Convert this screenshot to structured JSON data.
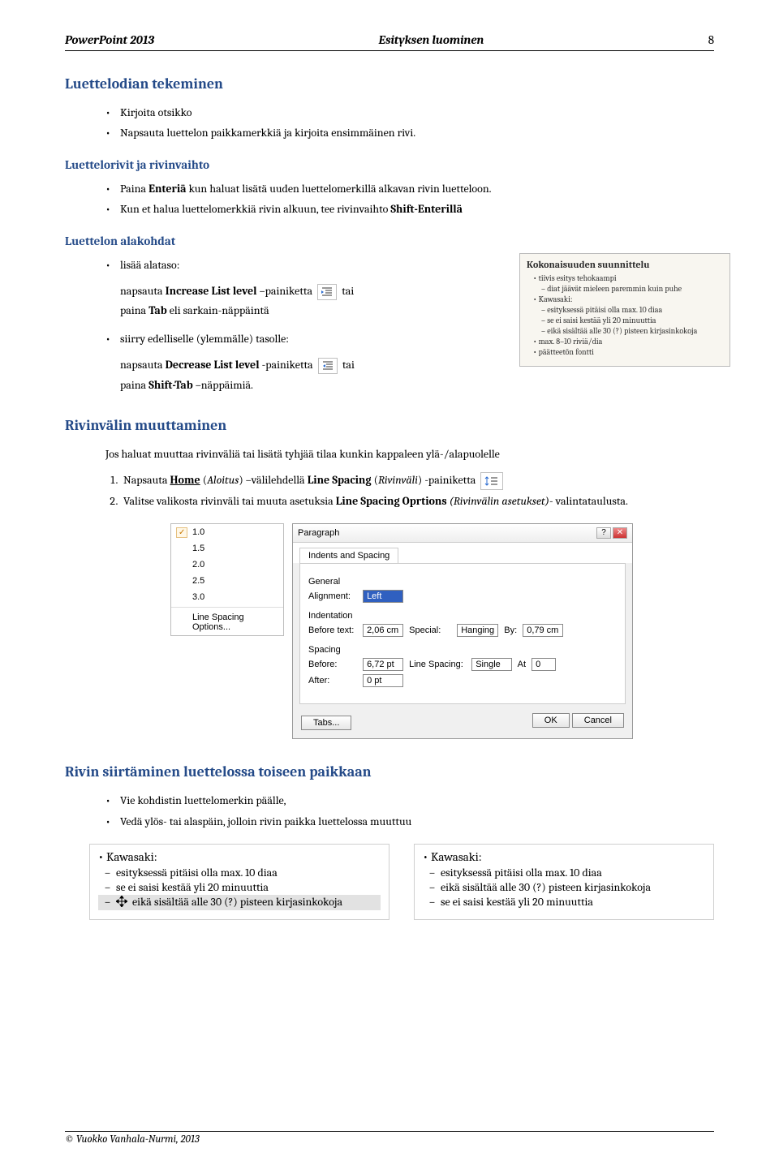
{
  "header": {
    "left": "PowerPoint 2013",
    "center": "Esityksen luominen",
    "right": "8"
  },
  "section1": {
    "title": "Luettelodian tekeminen",
    "bullets": {
      "b1": "Kirjoita otsikko",
      "b2": "Napsauta luettelon paikkamerkkiä ja kirjoita ensimmäinen rivi."
    }
  },
  "section2": {
    "title": "Luettelorivit ja rivinvaihto",
    "b1_pre": "Paina ",
    "b1_key": "Enteriä",
    "b1_post": " kun haluat lisätä uuden luettelomerkillä alkavan rivin luetteloon.",
    "b2_pre": "Kun et halua luettelomerkkiä rivin alkuun, tee rivinvaihto ",
    "b2_key": "Shift-Enterillä"
  },
  "section3": {
    "title": "Luettelon alakohdat",
    "b1": "lisää alataso:",
    "inc_pre": "napsauta ",
    "inc_bold": "Increase List level",
    "inc_mid": " –painiketta",
    "inc_post": " tai",
    "inc_line2_pre": "paina ",
    "inc_line2_key": "Tab",
    "inc_line2_post": " eli sarkain-näppäintä",
    "b2": "siirry edelliselle (ylemmälle) tasolle:",
    "dec_pre": "napsauta ",
    "dec_bold": "Decrease List level",
    "dec_mid": " -painiketta",
    "dec_post": " tai",
    "dec_line2_pre": "paina ",
    "dec_line2_key": "Shift-Tab",
    "dec_line2_post": " –näppäimiä."
  },
  "thumb": {
    "title": "Kokonaisuuden suunnittelu",
    "l1": "tiivis esitys tehokaampi",
    "l1s": "diat jäävät mieleen paremmin kuin puhe",
    "l2": "Kawasaki:",
    "l2a": "esityksessä pitäisi olla max. 10 diaa",
    "l2b": "se ei saisi kestää yli 20 minuuttia",
    "l2c": "eikä sisältää alle 30 (?) pisteen kirjasinkokoja",
    "l3": "max. 8–10 riviä/dia",
    "l4": "päätteetön fontti"
  },
  "section4": {
    "title": "Rivinvälin muuttaminen",
    "intro": "Jos haluat muuttaa rivinväliä tai lisätä tyhjää tilaa kunkin kappaleen ylä-/alapuolelle",
    "n1_pre": "Napsauta ",
    "n1_home_u": "Home",
    "n1_mid": " (",
    "n1_italic": "Aloitus",
    "n1_mid2": ") –välilehdellä ",
    "n1_bold": "Line Spacing",
    "n1_mid3": " (",
    "n1_italic2": "Rivinväli",
    "n1_post": ") -painiketta",
    "n2_pre": "Valitse valikosta rivinväli tai muuta asetuksia ",
    "n2_bold": "Line Spacing Oprtions ",
    "n2_italic": "(Rivinvälin asetukset)",
    "n2_post": "- valintataulusta."
  },
  "spacing_menu": {
    "o1": "1.0",
    "o2": "1.5",
    "o3": "2.0",
    "o4": "2.5",
    "o5": "3.0",
    "opt": "Line Spacing Options..."
  },
  "dialog": {
    "title": "Paragraph",
    "tab": "Indents and Spacing",
    "gen": "General",
    "align_lbl": "Alignment:",
    "align_val": "Left",
    "ind": "Indentation",
    "before_text_lbl": "Before text:",
    "before_text_val": "2,06 cm",
    "special_lbl": "Special:",
    "special_val": "Hanging",
    "by_lbl": "By:",
    "by_val": "0,79 cm",
    "spc": "Spacing",
    "before_lbl": "Before:",
    "before_val": "6,72 pt",
    "linesp_lbl": "Line Spacing:",
    "linesp_val": "Single",
    "at_lbl": "At",
    "at_val": "0",
    "after_lbl": "After:",
    "after_val": "0 pt",
    "tabs_btn": "Tabs...",
    "ok": "OK",
    "cancel": "Cancel"
  },
  "section5": {
    "title": "Rivin siirtäminen luettelossa toiseen paikkaan",
    "b1": "Vie kohdistin luettelomerkin päälle,",
    "b2": "Vedä ylös- tai alaspäin, jolloin rivin paikka luettelossa muuttuu"
  },
  "panels": {
    "left": {
      "top": "Kawasaki:",
      "l1": "esityksessä pitäisi olla max. 10 diaa",
      "l2": "se ei saisi kestää yli 20 minuuttia",
      "l3": "eikä sisältää alle 30 (?) pisteen kirjasinkokoja"
    },
    "right": {
      "top": "Kawasaki:",
      "l1": "esityksessä pitäisi olla max. 10 diaa",
      "l2": "eikä sisältää alle 30 (?) pisteen kirjasinkokoja",
      "l3": "se ei saisi kestää yli 20 minuuttia"
    }
  },
  "footer": {
    "text": "© Vuokko Vanhala-Nurmi, 2013"
  }
}
